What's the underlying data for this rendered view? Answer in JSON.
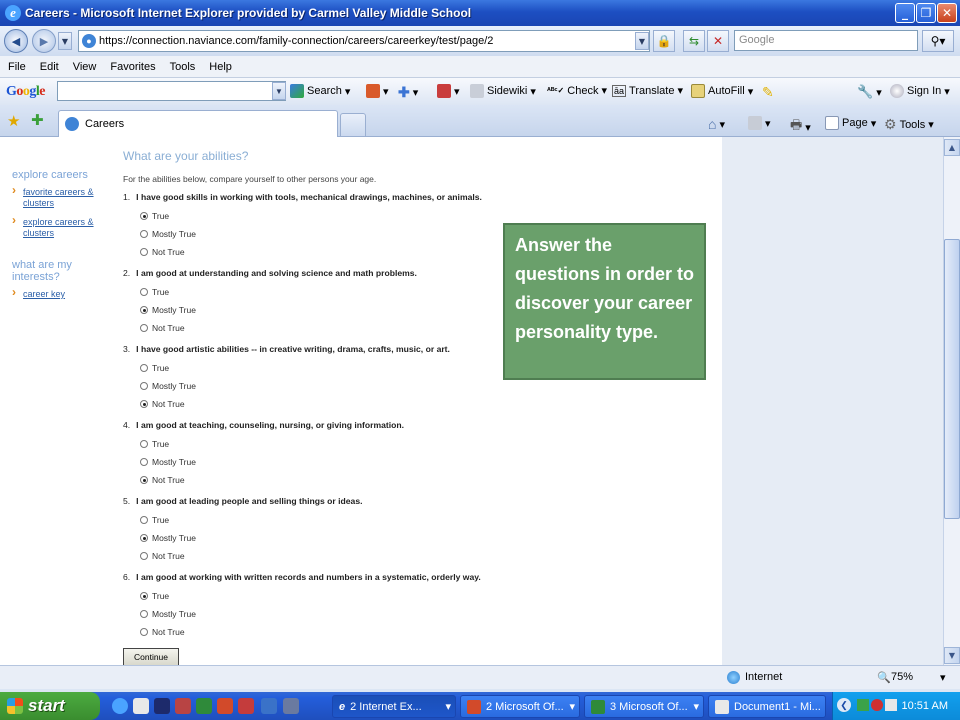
{
  "window": {
    "title": "Careers - Microsoft Internet Explorer provided by Carmel Valley Middle School",
    "minimize": "_",
    "maximize": "❐",
    "close": "✕"
  },
  "address_bar": {
    "url": "https://connection.naviance.com/family-connection/careers/careerkey/test/page/2",
    "search_placeholder": "Google"
  },
  "menu": [
    "File",
    "Edit",
    "View",
    "Favorites",
    "Tools",
    "Help"
  ],
  "google_toolbar": {
    "logo": "Google",
    "search": "Search",
    "sidewiki": "Sidewiki",
    "check": "Check",
    "translate": "Translate",
    "autofill": "AutoFill",
    "signin": "Sign In"
  },
  "tab": {
    "title": "Careers"
  },
  "command_bar": {
    "page": "Page",
    "tools": "Tools"
  },
  "left_nav": {
    "section1": "explore careers",
    "links1": [
      "favorite careers & clusters",
      "explore careers & clusters"
    ],
    "section2": "what are my interests?",
    "links2": [
      "career key"
    ]
  },
  "main": {
    "title": "What are your abilities?",
    "intro": "For the abilities below, compare yourself to other persons your age.",
    "questions": [
      {
        "num": "1.",
        "text": "I have good skills in working with tools, mechanical drawings, machines, or animals.",
        "options": [
          "True",
          "Mostly True",
          "Not True"
        ],
        "selected": "True"
      },
      {
        "num": "2.",
        "text": "I am good at understanding and solving science and math problems.",
        "options": [
          "True",
          "Mostly True",
          "Not True"
        ],
        "selected": "Mostly True"
      },
      {
        "num": "3.",
        "text": "I have good artistic abilities -- in creative writing, drama, crafts, music, or art.",
        "options": [
          "True",
          "Mostly True",
          "Not True"
        ],
        "selected": "Not True"
      },
      {
        "num": "4.",
        "text": "I am good at teaching, counseling, nursing, or giving information.",
        "options": [
          "True",
          "Mostly True",
          "Not True"
        ],
        "selected": "Not True"
      },
      {
        "num": "5.",
        "text": "I am good at leading people and selling things or ideas.",
        "options": [
          "True",
          "Mostly True",
          "Not True"
        ],
        "selected": "Mostly True"
      },
      {
        "num": "6.",
        "text": "I am good at working with written records and numbers in a systematic, orderly way.",
        "options": [
          "True",
          "Mostly True",
          "Not True"
        ],
        "selected": "True"
      }
    ],
    "continue_label": "Continue"
  },
  "callout": {
    "text": "Answer the questions in order to discover your career personality type."
  },
  "status_bar": {
    "zone": "Internet",
    "zoom": "75%"
  },
  "taskbar": {
    "start": "start",
    "buttons": [
      "2 Internet Ex...",
      "2 Microsoft Of...",
      "3 Microsoft Of...",
      "Document1 - Mi..."
    ],
    "clock": "10:51 AM"
  }
}
